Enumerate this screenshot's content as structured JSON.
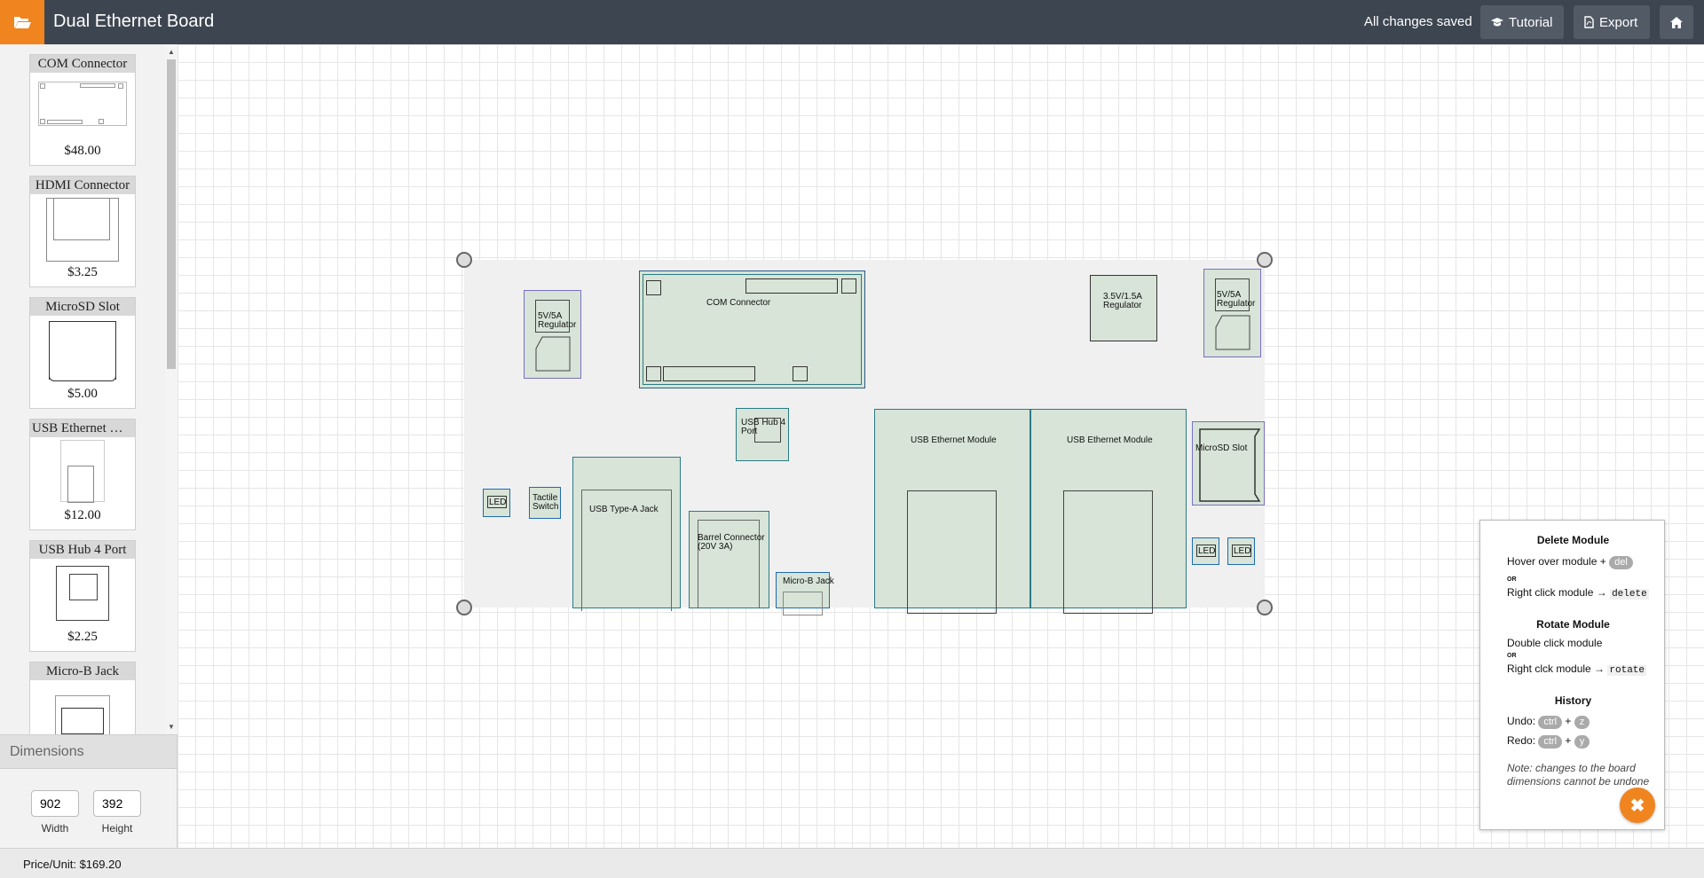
{
  "topbar": {
    "title": "Dual Ethernet Board",
    "status": "All changes saved",
    "tutorial_label": "Tutorial",
    "export_label": "Export"
  },
  "catalog": [
    {
      "name": "COM Connector",
      "price": "$48.00"
    },
    {
      "name": "HDMI Connector",
      "price": "$3.25"
    },
    {
      "name": "MicroSD Slot",
      "price": "$5.00"
    },
    {
      "name": "USB Ethernet M…",
      "price": "$12.00"
    },
    {
      "name": "USB Hub 4 Port",
      "price": "$2.25"
    },
    {
      "name": "Micro-B Jack",
      "price": ""
    }
  ],
  "dimensions": {
    "heading": "Dimensions",
    "width": "902",
    "height": "392",
    "width_label": "Width",
    "height_label": "Height"
  },
  "footer": {
    "price_unit": "Price/Unit: $169.20"
  },
  "board_modules": {
    "reg_5v_left": [
      "5V/5A",
      "Regulator"
    ],
    "com": "COM Connector",
    "reg_3v5": [
      "3.5V/1.5A",
      "Regulator"
    ],
    "reg_5v_right": [
      "5V/5A",
      "Regulator"
    ],
    "usb_hub": [
      "USB Hub 4",
      "Port"
    ],
    "usb_eth_1": "USB Ethernet Module",
    "usb_eth_2": "USB Ethernet Module",
    "microsd": "MicroSD Slot",
    "led_1": "LED",
    "tactile": [
      "Tactile",
      "Switch"
    ],
    "usb_a": "USB Type-A Jack",
    "barrel": [
      "Barrel Connector",
      "(20V 3A)"
    ],
    "micro_b": "Micro-B Jack",
    "led_2": "LED",
    "led_3": "LED"
  },
  "help": {
    "delete_title": "Delete Module",
    "delete_line1": "Hover over module +",
    "del_key": "del",
    "or": "OR",
    "delete_line2": "Right click module →",
    "delete_code": "delete",
    "rotate_title": "Rotate Module",
    "rotate_line1": "Double click module",
    "rotate_line2": "Right clck module →",
    "rotate_code": "rotate",
    "history_title": "History",
    "undo_label": "Undo:",
    "redo_label": "Redo:",
    "ctrl_key": "ctrl",
    "z_key": "z",
    "y_key": "y",
    "plus": "+",
    "note": "Note: changes to the board dimensions cannot be undone"
  }
}
